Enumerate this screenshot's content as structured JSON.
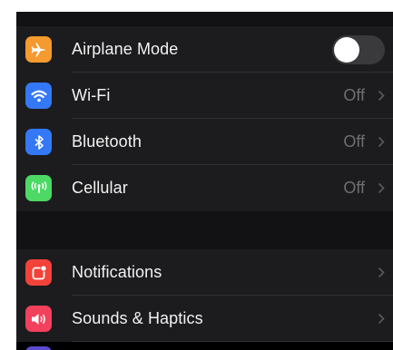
{
  "settings": {
    "group1": [
      {
        "label": "Airplane Mode",
        "icon": "airplane-icon",
        "color": "#f49a2e",
        "control": "toggle",
        "toggle_on": false
      },
      {
        "label": "Wi-Fi",
        "icon": "wifi-icon",
        "color": "#3478f6",
        "value": "Off"
      },
      {
        "label": "Bluetooth",
        "icon": "bluetooth-icon",
        "color": "#3478f6",
        "value": "Off"
      },
      {
        "label": "Cellular",
        "icon": "cellular-icon",
        "color": "#4cd964",
        "value": "Off"
      }
    ],
    "group2": [
      {
        "label": "Notifications",
        "icon": "notifications-icon",
        "color": "#f2423a"
      },
      {
        "label": "Sounds & Haptics",
        "icon": "speaker-icon",
        "color": "#f2415d"
      }
    ],
    "next_row_icon_color": "#5b4bd3"
  }
}
